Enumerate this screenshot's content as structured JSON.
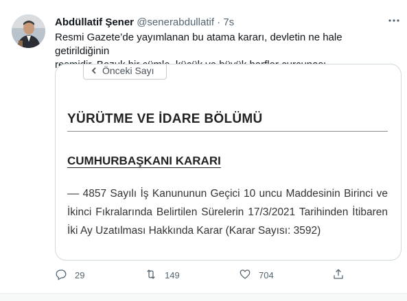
{
  "tweet": {
    "author_name": "Abdüllatif Şener",
    "handle": "@senerabdullatif",
    "separator": "·",
    "time": "7s",
    "text_line1": "Resmi Gazete’de yayımlanan bu atama kararı, devletin ne hale getirildiğinin",
    "text_line2": "resmidir. Bozuk bir cümle, küçük ve büyük harfler curcunası..."
  },
  "media": {
    "prev_button": "Önceki Sayı",
    "section_title": "YÜRÜTME VE İDARE BÖLÜMÜ",
    "decree_title": "CUMHURBAŞKANI KARARI",
    "decree_text": "–– 4857 Sayılı İş Kanununun Geçici 10 uncu Maddesinin Birinci ve İkinci Fıkralarında Belirtilen Sürelerin 17/3/2021 Tarihinden İtibaren İki Ay Uzatılması Hakkında Karar (Karar Sayısı: 3592)"
  },
  "actions": {
    "reply_count": "29",
    "retweet_count": "149",
    "like_count": "704"
  },
  "icons": {
    "more": "more-icon",
    "reply": "reply-icon",
    "retweet": "retweet-icon",
    "like": "heart-icon",
    "share": "share-icon"
  },
  "colors": {
    "text_primary": "#0f1419",
    "text_secondary": "#536471",
    "border": "#cfd9de"
  }
}
